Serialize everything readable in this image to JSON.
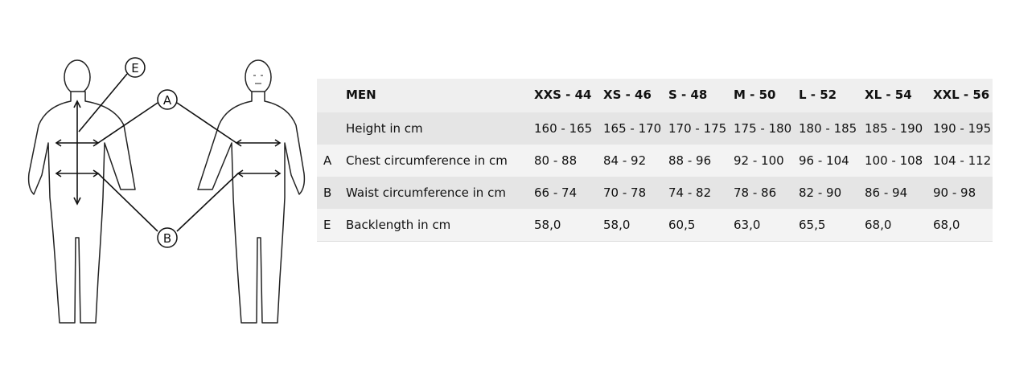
{
  "figure": {
    "markers": [
      "E",
      "A",
      "B"
    ]
  },
  "table": {
    "header": {
      "group": "MEN",
      "sizes": [
        "XXS - 44",
        "XS - 46",
        "S - 48",
        "M - 50",
        "L - 52",
        "XL - 54",
        "XXL - 56"
      ]
    },
    "rows": [
      {
        "code": "",
        "label": "Height in cm",
        "values": [
          "160 - 165",
          "165 - 170",
          "170 - 175",
          "175 - 180",
          "180 - 185",
          "185 - 190",
          "190 - 195"
        ]
      },
      {
        "code": "A",
        "label": "Chest circumference in cm",
        "values": [
          "80 - 88",
          "84 - 92",
          "88 - 96",
          "92 - 100",
          "96 - 104",
          "100 - 108",
          "104 - 112"
        ]
      },
      {
        "code": "B",
        "label": "Waist circumference in cm",
        "values": [
          "66 - 74",
          "70 - 78",
          "74 - 82",
          "78 - 86",
          "82 - 90",
          "86 - 94",
          "90 - 98"
        ]
      },
      {
        "code": "E",
        "label": "Backlength in cm",
        "values": [
          "58,0",
          "58,0",
          "60,5",
          "63,0",
          "65,5",
          "68,0",
          "68,0"
        ]
      }
    ]
  }
}
